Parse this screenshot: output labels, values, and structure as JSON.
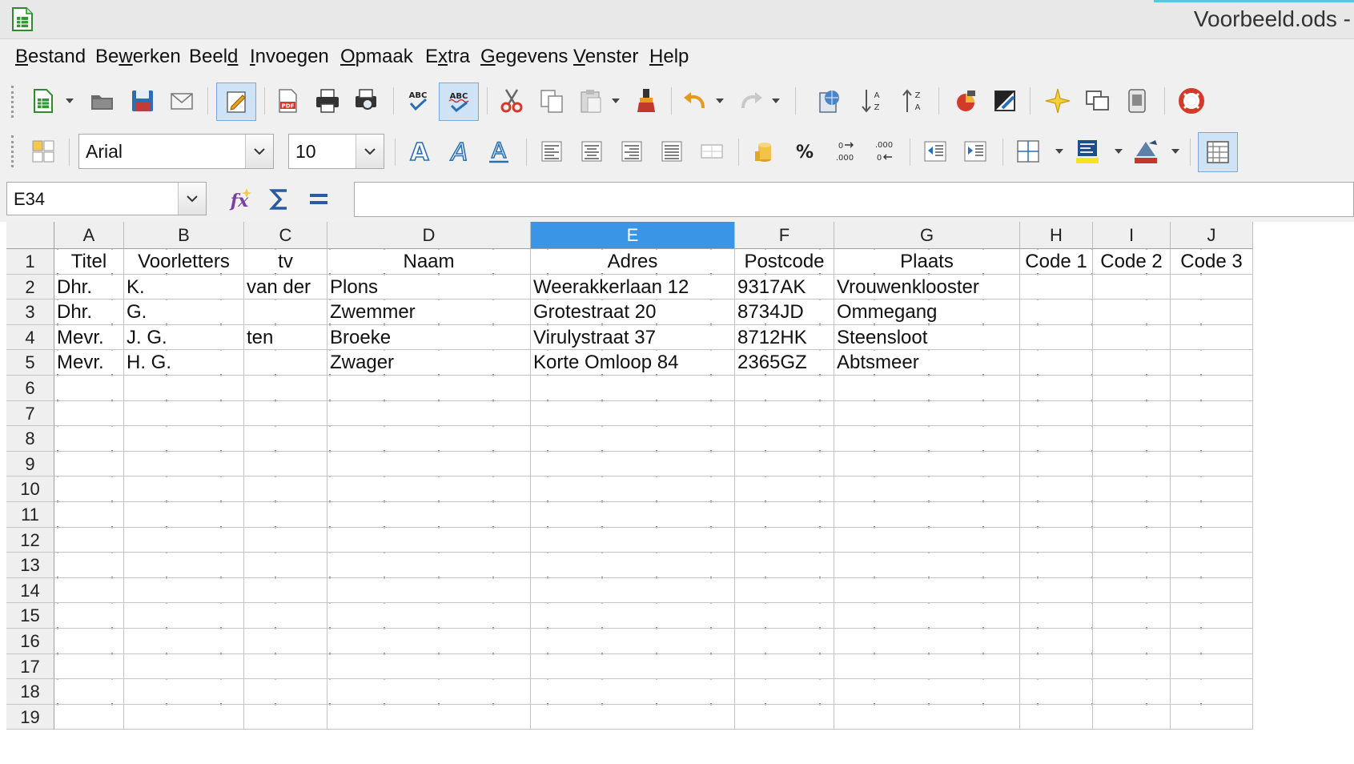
{
  "window": {
    "title": "Voorbeeld.ods -"
  },
  "menu": [
    "Bestand",
    "Bewerken",
    "Beeld",
    "Invoegen",
    "Opmaak",
    "Extra",
    "Gegevens",
    "Venster",
    "Help"
  ],
  "menu_mnemonic": [
    [
      "",
      "B",
      "estand"
    ],
    [
      "Be",
      "w",
      "erken"
    ],
    [
      "Beel",
      "d",
      ""
    ],
    [
      "",
      "I",
      "nvoegen"
    ],
    [
      "",
      "O",
      "pmaak"
    ],
    [
      "E",
      "x",
      "tra"
    ],
    [
      "",
      "G",
      "egevens"
    ],
    [
      "",
      "V",
      "enster"
    ],
    [
      "",
      "H",
      "elp"
    ]
  ],
  "format": {
    "font_name": "Arial",
    "font_size": "10"
  },
  "formula_bar": {
    "cell_reference": "E34",
    "content": ""
  },
  "sheet": {
    "columns": [
      "A",
      "B",
      "C",
      "D",
      "E",
      "F",
      "G",
      "H",
      "I",
      "J"
    ],
    "selected_column": "E",
    "rows": [
      [
        "Titel",
        "Voorletters",
        "tv",
        "Naam",
        "Adres",
        "Postcode",
        "Plaats",
        "Code 1",
        "Code 2",
        "Code 3"
      ],
      [
        "Dhr.",
        "K.",
        "van der",
        "Plons",
        "Weerakkerlaan 12",
        "9317AK",
        "Vrouwenklooster",
        "",
        "",
        ""
      ],
      [
        "Dhr.",
        "G.",
        "",
        "Zwemmer",
        "Grotestraat 20",
        "8734JD",
        "Ommegang",
        "",
        "",
        ""
      ],
      [
        "Mevr.",
        "J. G.",
        "ten",
        "Broeke",
        "Virulystraat 37",
        "8712HK",
        "Steensloot",
        "",
        "",
        ""
      ],
      [
        "Mevr.",
        "H. G.",
        "",
        "Zwager",
        "Korte Omloop 84",
        "2365GZ",
        "Abtsmeer",
        "",
        "",
        ""
      ]
    ],
    "row_numbers": [
      "1",
      "2",
      "3",
      "4",
      "5",
      "6",
      "7",
      "8",
      "9",
      "10",
      "11",
      "12",
      "13",
      "14",
      "15",
      "16",
      "17",
      "18",
      "19"
    ]
  },
  "colors": {
    "selected_header": "#3a95e6",
    "header_bg": "#efefef"
  }
}
